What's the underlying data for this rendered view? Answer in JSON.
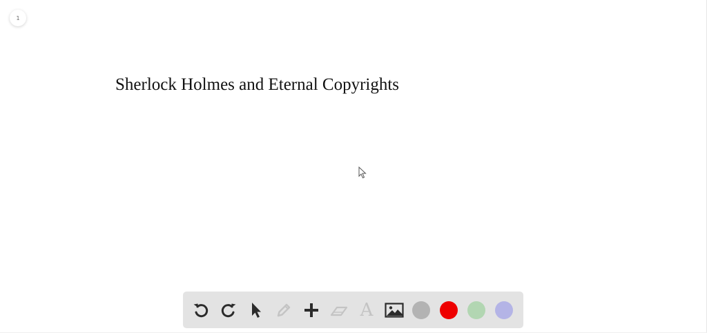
{
  "page": {
    "indicator": "1"
  },
  "board": {
    "title": "Sherlock Holmes and Eternal Copyrights"
  },
  "toolbar": {
    "tools": [
      {
        "name": "undo-icon",
        "enabled": true
      },
      {
        "name": "redo-icon",
        "enabled": true
      },
      {
        "name": "pointer-icon",
        "enabled": true
      },
      {
        "name": "pencil-icon",
        "enabled": false
      },
      {
        "name": "plus-icon",
        "enabled": true
      },
      {
        "name": "eraser-icon",
        "enabled": false
      },
      {
        "name": "text-icon",
        "enabled": false
      },
      {
        "name": "image-icon",
        "enabled": true
      }
    ],
    "text_tool_glyph": "A",
    "colors": [
      {
        "name": "gray",
        "hex": "#b3b3b3"
      },
      {
        "name": "red",
        "hex": "#ee0000"
      },
      {
        "name": "green",
        "hex": "#b2d6b2"
      },
      {
        "name": "lavender",
        "hex": "#b4b4e6"
      }
    ]
  }
}
